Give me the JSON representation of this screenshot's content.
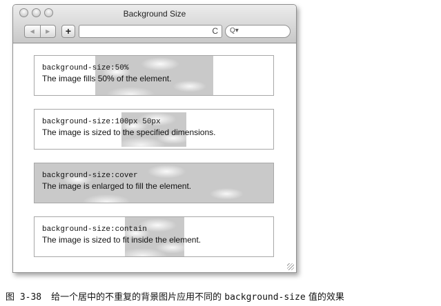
{
  "window": {
    "title": "Background Size",
    "nav_back": "◀",
    "nav_forward": "▶",
    "add_label": "+",
    "reload_glyph": "C",
    "search_glyph": "Q▾"
  },
  "demos": [
    {
      "code": "background-size:50%",
      "description": "The image fills 50% of the element."
    },
    {
      "code": "background-size:100px 50px",
      "description": "The image is sized to the specified dimensions."
    },
    {
      "code": "background-size:cover",
      "description": "The image is enlarged to fill the element."
    },
    {
      "code": "background-size:contain",
      "description": "The image is sized to fit inside the element."
    }
  ],
  "caption": {
    "number": "图 3-38",
    "before": "给一个居中的不重复的背景图片应用不同的 ",
    "code": "background-size",
    "after": " 值的效果"
  }
}
